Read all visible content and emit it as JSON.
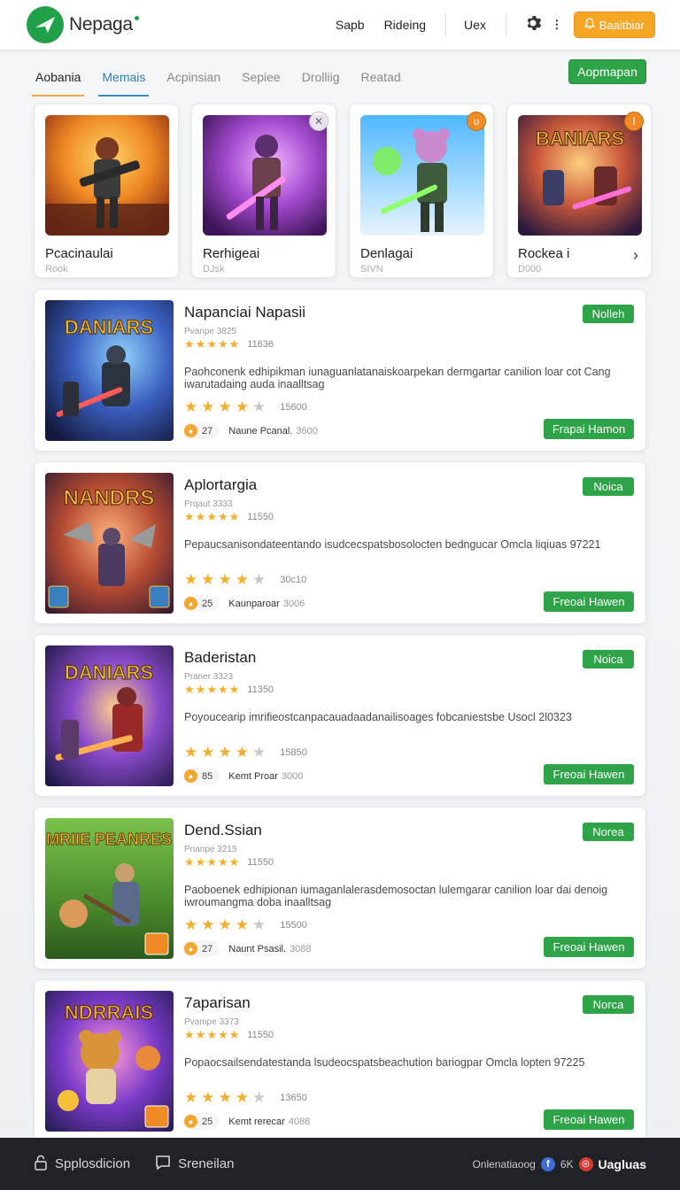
{
  "header": {
    "logo_text": "Nepaga",
    "nav": [
      "Sapb",
      "Rideing",
      "Uex"
    ],
    "action_label": "Baaitbiar"
  },
  "tabs": {
    "items": [
      "Aobania",
      "Memais",
      "Acpinsian",
      "Sepiee",
      "Drolliig",
      "Reatad"
    ],
    "button_label": "Aopmapan"
  },
  "featured": [
    {
      "title": "Pcacinaulai",
      "sub": "Rook"
    },
    {
      "title": "Rerhigeai",
      "sub": "DJsk"
    },
    {
      "title": "Denlagai",
      "sub": "SIVN"
    },
    {
      "title": "Rockea i",
      "sub": "D000"
    }
  ],
  "thumb_text": [
    "DANIARS",
    "NANDRS",
    "DANIARS",
    "MRIIE PEANRES",
    "NDRRAIS",
    "BANIARS"
  ],
  "list": [
    {
      "title": "Napanciai Napasii",
      "meta": "Pvanpe 3825",
      "rating_count": "11636",
      "desc": "Paohconenk edhipikman iunaguanlatanaiskoarpekan dermgartar canilion loar cot Cang iwarutadaing auda inaalltsag",
      "rating_count2": "15600",
      "stars": 4,
      "coin": "27",
      "author": "Naune Pcanal.",
      "author_count": "3600",
      "tag": "Nolleh",
      "action": "Frapai Hamon"
    },
    {
      "title": "Aplortargia",
      "meta": "Prqaut 3333",
      "rating_count": "11550",
      "desc": "Pepaucsanisondateentando isudcecspatsbosolocten bedngucar Omcla liqiuas 97221",
      "rating_count2": "30c10",
      "stars": 4,
      "coin": "25",
      "author": "Kaunparoar",
      "author_count": "3006",
      "tag": "Noica",
      "action": "Freoai Hawen"
    },
    {
      "title": "Baderistan",
      "meta": "Praner 3323",
      "rating_count": "11350",
      "desc": "Poyoucearip imrifieostcanpacauadaadanailisoages fobcaniestsbe Usocl 2l0323",
      "rating_count2": "15850",
      "stars": 4,
      "coin": "85",
      "author": "Kemt Proar",
      "author_count": "3000",
      "tag": "Noica",
      "action": "Freoai Hawen"
    },
    {
      "title": "Dend.Ssian",
      "meta": "Pnanpe 3215",
      "rating_count": "11550",
      "desc": "Paoboenek edhipionan iumaganlalerasdemosoctan lulemgarar canilion loar dai denoig iwroumangma doba inaalltsag",
      "rating_count2": "15500",
      "stars": 4,
      "coin": "27",
      "author": "Naunt Psasil.",
      "author_count": "3088",
      "tag": "Norea",
      "action": "Freoai Hawen"
    },
    {
      "title": "7aparisan",
      "meta": "Pvampe 3373",
      "rating_count": "11550",
      "desc": "Popaocsailsendatestanda lsudeocspatsbeachution bariogpar Omcla lopten 97225",
      "rating_count2": "13650",
      "stars": 4,
      "coin": "25",
      "author": "Kemt rerecar",
      "author_count": "4088",
      "tag": "Norca",
      "action": "Freoai Hawen"
    }
  ],
  "footer": {
    "left1": "Spplosdicion",
    "left2": "Sreneilan",
    "right_text": "Onlenatiaoog",
    "count": "6K",
    "brand": "Uagluas"
  },
  "colors": {
    "accent_green": "#2ea347",
    "accent_orange": "#f5a623",
    "star": "#f3ae2d"
  }
}
